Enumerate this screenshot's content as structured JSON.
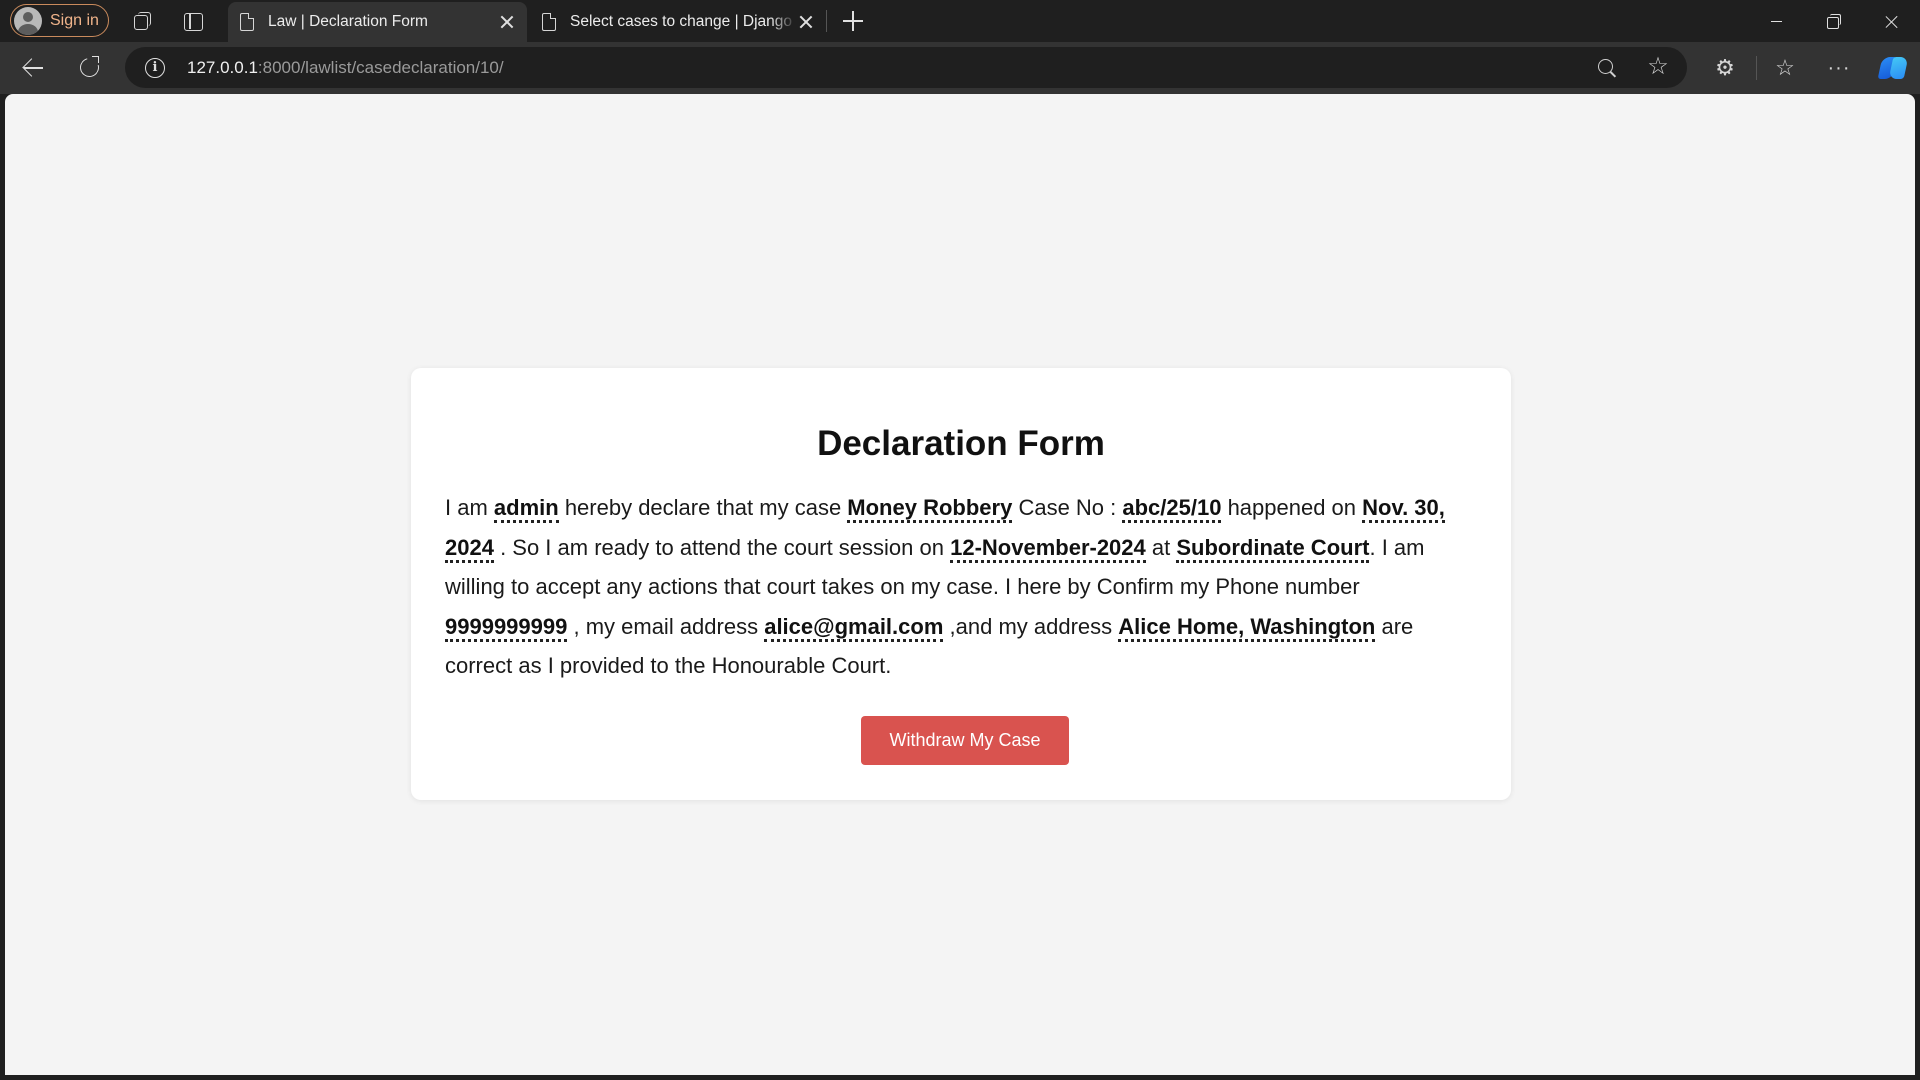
{
  "browser": {
    "sign_in_label": "Sign in",
    "tabs": [
      {
        "title": "Law | Declaration Form",
        "active": true
      },
      {
        "title": "Select cases to change | Django site admin",
        "active": false
      }
    ],
    "url_host": "127.0.0.1",
    "url_path": ":8000/lawlist/casedeclaration/10/",
    "icons": [
      "workspaces-icon",
      "tab-actions-icon",
      "page-icon",
      "close-icon",
      "new-tab-icon",
      "back-icon",
      "reload-icon",
      "info-icon",
      "zoom-icon",
      "star-icon",
      "extensions-icon",
      "favorites-icon",
      "more-icon",
      "copilot-icon",
      "minimize-icon",
      "restore-icon",
      "close-window-icon"
    ]
  },
  "page": {
    "title": "Declaration Form",
    "statement": {
      "t1": "I am ",
      "user": "admin",
      "t2": " hereby declare that my case ",
      "case_name": "Money Robbery",
      "t3": " Case No : ",
      "case_no": "abc/25/10",
      "t4": " happened on ",
      "happened_on": "Nov. 30, 2024",
      "t5": " . So I am ready to attend the court session on ",
      "session_date": "12-November-2024",
      "t6": " at ",
      "court": "Subordinate Court",
      "t7": ". I am willing to accept any actions that court takes on my case. I here by Confirm my Phone number ",
      "phone": "9999999999",
      "t8": " , my email address ",
      "email": "alice@gmail.com",
      "t9": " ,and my address ",
      "address": "Alice Home, Washington",
      "t10": " are correct as I provided to the Honourable Court."
    },
    "withdraw_label": "Withdraw My Case",
    "colors": {
      "button": "#d9534f",
      "page_bg": "#f4f4f4",
      "card_bg": "#ffffff"
    }
  }
}
